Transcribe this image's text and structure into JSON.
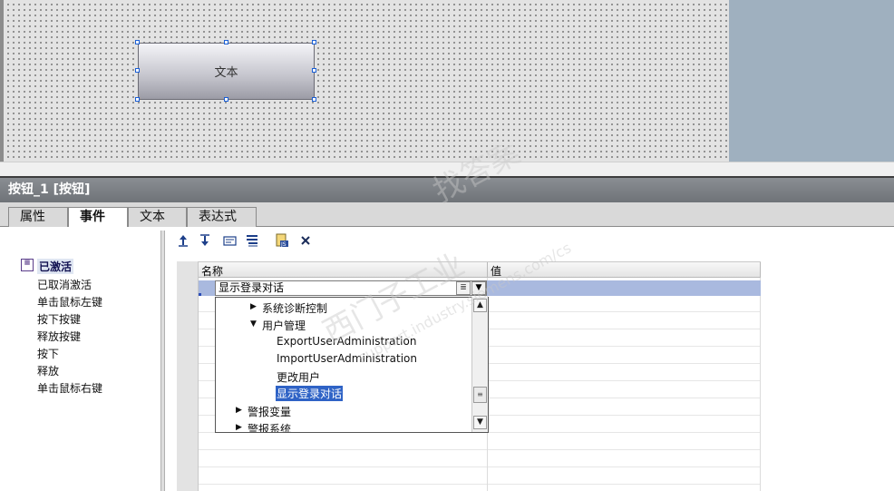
{
  "canvas": {
    "button_text": "文本",
    "colors": {
      "background": "#e3e3e3",
      "right_panel": "#9fb0bf"
    }
  },
  "inspector": {
    "title": "按钮_1 [按钮]",
    "tabs": [
      "属性",
      "事件",
      "文本",
      "表达式"
    ],
    "active_tab": "事件"
  },
  "events": {
    "active": "已激活",
    "items": [
      "已取消激活",
      "单击鼠标左键",
      "按下按键",
      "释放按键",
      "按下",
      "释放",
      "单击鼠标右键"
    ]
  },
  "toolbar": {
    "icons": [
      "move-up-icon",
      "move-down-icon",
      "insert-folder-icon",
      "list-icon",
      "script-icon",
      "delete-icon"
    ]
  },
  "grid": {
    "headers": {
      "name": "名称",
      "value": "值"
    },
    "current_function": "显示登录对话"
  },
  "dropdown": {
    "tree": [
      {
        "label": "系统诊断控制",
        "expanded": false
      },
      {
        "label": "用户管理",
        "expanded": true
      },
      {
        "label": "ExportUserAdministration"
      },
      {
        "label": "ImportUserAdministration"
      },
      {
        "label": "更改用户"
      },
      {
        "label": "显示登录对话",
        "selected": true
      },
      {
        "label": "警报变量",
        "expanded": false
      },
      {
        "label": "警报系统",
        "expanded": false
      }
    ]
  },
  "watermark": {
    "line1": "找答案",
    "line2": "西门子工业",
    "line3": "support.industry.siemens.com/cs"
  }
}
